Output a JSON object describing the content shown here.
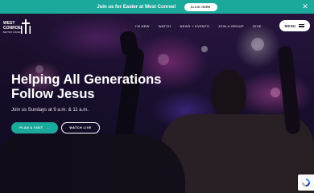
{
  "announcement": {
    "text": "Join us for Easter at West Conroe!",
    "button_label": "CLICK HERE",
    "close_icon": "close-icon",
    "background": "#1aa99b"
  },
  "logo": {
    "line1": "WEST",
    "line2": "CONROE",
    "line3": "BAPTIST CHURCH",
    "icon": "cross-icon"
  },
  "nav": {
    "items": [
      {
        "label": "I'M NEW"
      },
      {
        "label": "WATCH"
      },
      {
        "label": "NEWS + EVENTS"
      },
      {
        "label": "JOIN A GROUP"
      },
      {
        "label": "GIVE"
      }
    ],
    "menu_label": "MENU",
    "menu_icon": "hamburger-icon"
  },
  "hero": {
    "headline": "Helping All Generations Follow Jesus",
    "subhead": "Join us Sundays at 9 a.m. & 11 a.m.",
    "primary_button": "PLAN A VISIT",
    "primary_icon": "arrow-right-icon",
    "secondary_button": "WATCH LIVE"
  },
  "colors": {
    "accent": "#1aa99b",
    "white": "#ffffff"
  }
}
